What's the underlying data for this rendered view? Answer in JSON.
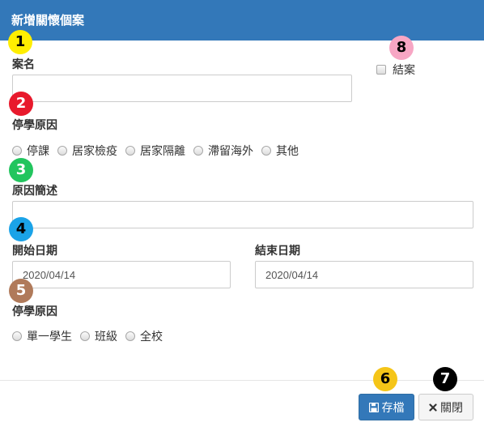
{
  "header": {
    "title": "新增關懷個案"
  },
  "fields": {
    "case_name": {
      "label": "案名",
      "value": "",
      "placeholder": ""
    },
    "suspension_reason": {
      "label": "停學原因",
      "options": [
        "停課",
        "居家檢疫",
        "居家隔離",
        "滯留海外",
        "其他"
      ]
    },
    "reason_description": {
      "label": "原因簡述",
      "value": "",
      "placeholder": ""
    },
    "start_date": {
      "label": "開始日期",
      "value": "2020/04/14"
    },
    "end_date": {
      "label": "結束日期",
      "value": "2020/04/14"
    },
    "scope": {
      "label": "停學原因",
      "options": [
        "單一學生",
        "班級",
        "全校"
      ]
    },
    "closed": {
      "label": "結案",
      "checked": false
    }
  },
  "footer": {
    "save_label": "存檔",
    "close_label": "關閉"
  },
  "badges": [
    {
      "number": "1",
      "color": "#ffee00",
      "text_color": "#000000"
    },
    {
      "number": "2",
      "color": "#e8192c",
      "text_color": "#ffffff"
    },
    {
      "number": "3",
      "color": "#22c55e",
      "text_color": "#ffffff"
    },
    {
      "number": "4",
      "color": "#1aa3e8",
      "text_color": "#000000"
    },
    {
      "number": "5",
      "color": "#b07a5a",
      "text_color": "#ffffff"
    },
    {
      "number": "6",
      "color": "#f5c518",
      "text_color": "#000000"
    },
    {
      "number": "7",
      "color": "#000000",
      "text_color": "#ffffff"
    },
    {
      "number": "8",
      "color": "#f7a6c4",
      "text_color": "#000000"
    }
  ],
  "colors": {
    "header_bg": "#3378b9",
    "primary_button": "#3378b9"
  },
  "icons": {
    "save": "floppy-disk-icon",
    "close": "x-icon"
  }
}
